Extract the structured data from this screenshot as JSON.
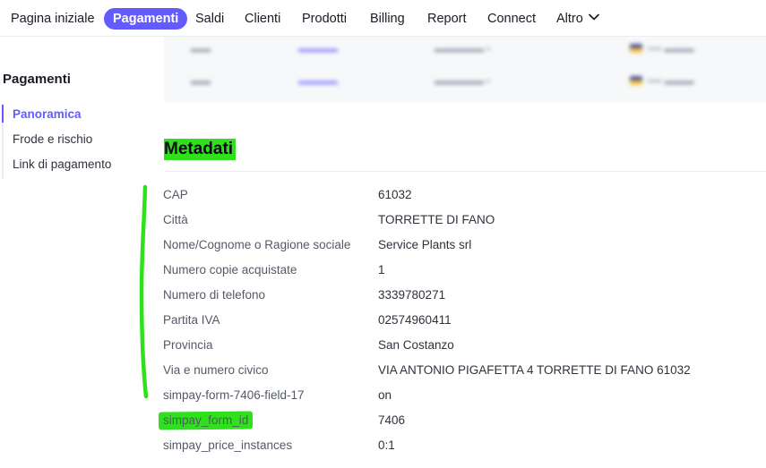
{
  "nav": {
    "items": [
      {
        "id": "home",
        "label": "Pagina iniziale"
      },
      {
        "id": "payments",
        "label": "Pagamenti",
        "active": true
      },
      {
        "id": "balances",
        "label": "Saldi"
      },
      {
        "id": "customers",
        "label": "Clienti"
      },
      {
        "id": "products",
        "label": "Prodotti"
      },
      {
        "id": "billing",
        "label": "Billing"
      },
      {
        "id": "reports",
        "label": "Report"
      },
      {
        "id": "connect",
        "label": "Connect"
      },
      {
        "id": "more",
        "label": "Altro"
      }
    ],
    "more_icon": "chevron-down-icon"
  },
  "sidebar": {
    "title": "Pagamenti",
    "items": [
      {
        "label": "Panoramica",
        "active": true
      },
      {
        "label": "Frode e rischio"
      },
      {
        "label": "Link di pagamento"
      }
    ]
  },
  "metadata": {
    "title": "Metadati",
    "rows": [
      {
        "key": "CAP",
        "value": "61032"
      },
      {
        "key": "Città",
        "value": "TORRETTE DI FANO"
      },
      {
        "key": "Nome/Cognome o Ragione sociale",
        "value": "Service Plants srl"
      },
      {
        "key": "Numero copie acquistate",
        "value": "1"
      },
      {
        "key": "Numero di telefono",
        "value": "3339780271"
      },
      {
        "key": "Partita IVA",
        "value": "02574960411"
      },
      {
        "key": "Provincia",
        "value": "San Costanzo"
      },
      {
        "key": "Via e numero civico",
        "value": "VIA ANTONIO PIGAFETTA 4 TORRETTE DI FANO 61032"
      },
      {
        "key": "simpay-form-7406-field-17",
        "value": "on"
      },
      {
        "key": "simpay_form_id",
        "value": "7406"
      },
      {
        "key": "simpay_price_instances",
        "value": "0:1"
      }
    ]
  },
  "colors": {
    "accent": "#635bff",
    "highlight": "#2fe01c",
    "panel_bg": "#f6f8fa"
  }
}
